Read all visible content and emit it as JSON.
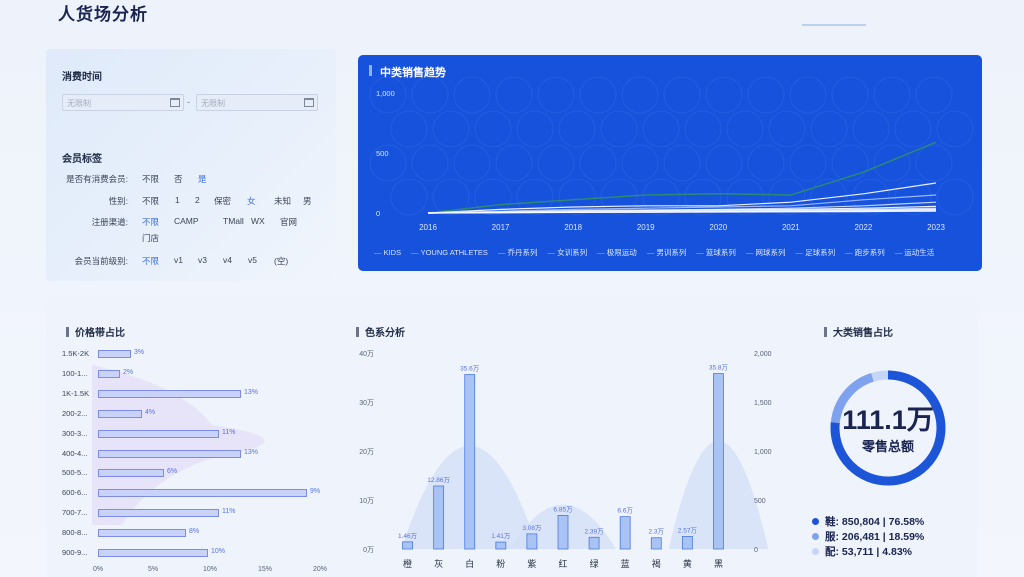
{
  "page": {
    "title": "人货场分析"
  },
  "filters": {
    "consume_time_label": "消费时间",
    "date_start_placeholder": "无限制",
    "date_end_placeholder": "无限制",
    "date_separator": "-",
    "member_tags_label": "会员标签",
    "rows": [
      {
        "label": "是否有消费会员:",
        "options": [
          "不限",
          "否",
          "是"
        ],
        "active": 2
      },
      {
        "label": "性别:",
        "options": [
          "不限",
          "1",
          "2",
          "保密",
          "女",
          "未知",
          "男"
        ],
        "active": 4
      },
      {
        "label": "注册渠道:",
        "options": [
          "不限",
          "CAMP",
          "TMall",
          "WX",
          "官网",
          "门店"
        ],
        "active": 0
      },
      {
        "label": "会员当前级别:",
        "options": [
          "不限",
          "v1",
          "v3",
          "v4",
          "v5",
          "(空)"
        ],
        "active": 0
      }
    ]
  },
  "trend": {
    "title": "中类销售趋势",
    "legend": [
      "KIDS",
      "YOUNG ATHLETES",
      "乔丹系列",
      "女训系列",
      "极限运动",
      "男训系列",
      "篮球系列",
      "网球系列",
      "足球系列",
      "跑步系列",
      "运动生活"
    ]
  },
  "chart_data": [
    {
      "type": "line",
      "title": "中类销售趋势",
      "x": [
        "2016",
        "2017",
        "2018",
        "2019",
        "2020",
        "2021",
        "2022",
        "2023"
      ],
      "yticks": [
        "0",
        "500",
        "1,000"
      ],
      "ylim": [
        0,
        1000
      ],
      "series": [
        {
          "name": "KIDS",
          "color": "#2e8f6a",
          "values": [
            0,
            70,
            110,
            150,
            160,
            150,
            340,
            590
          ]
        },
        {
          "name": "YOUNG ATHLETES",
          "color": "#ffffff",
          "values": [
            0,
            30,
            50,
            60,
            60,
            90,
            160,
            250
          ]
        },
        {
          "name": "乔丹系列",
          "color": "#a9c2ff",
          "values": [
            0,
            15,
            30,
            40,
            50,
            60,
            110,
            150
          ]
        },
        {
          "name": "女训系列",
          "color": "#d6e2ff",
          "values": [
            0,
            10,
            20,
            25,
            30,
            40,
            60,
            90
          ]
        },
        {
          "name": "极限运动",
          "color": "#c6d6ff",
          "values": [
            0,
            5,
            10,
            15,
            15,
            20,
            30,
            40
          ]
        },
        {
          "name": "男训系列",
          "color": "#ffffff",
          "values": [
            0,
            8,
            15,
            20,
            25,
            30,
            40,
            55
          ]
        },
        {
          "name": "篮球系列",
          "color": "#e3ebff",
          "values": [
            0,
            5,
            10,
            12,
            15,
            18,
            22,
            30
          ]
        },
        {
          "name": "网球系列",
          "color": "#b9ccff",
          "values": [
            0,
            3,
            6,
            8,
            10,
            12,
            16,
            20
          ]
        },
        {
          "name": "足球系列",
          "color": "#f0f4ff",
          "values": [
            0,
            4,
            8,
            10,
            12,
            15,
            18,
            25
          ]
        },
        {
          "name": "跑步系列",
          "color": "#dfe8ff",
          "values": [
            0,
            6,
            12,
            15,
            18,
            22,
            28,
            35
          ]
        },
        {
          "name": "运动生活",
          "color": "#ffffff",
          "values": [
            0,
            2,
            5,
            6,
            8,
            10,
            12,
            15
          ]
        }
      ]
    },
    {
      "type": "bar",
      "title": "价格带占比",
      "categories": [
        "1.5K-2K",
        "100-1...",
        "1K-1.5K",
        "200-2...",
        "300-3...",
        "400-4...",
        "500-5...",
        "600-6...",
        "700-7...",
        "800-8...",
        "900-9..."
      ],
      "values": [
        3,
        2,
        13,
        4,
        11,
        13,
        6,
        19,
        11,
        8,
        10
      ],
      "value_labels": [
        "3%",
        "2%",
        "13%",
        "4%",
        "11%",
        "13%",
        "6%",
        "9%",
        "11%",
        "8%",
        "10%"
      ],
      "xticks": [
        "0%",
        "5%",
        "10%",
        "15%",
        "20%"
      ],
      "xlim": [
        0,
        20
      ]
    },
    {
      "type": "bar",
      "title": "色系分析",
      "categories": [
        "橙",
        "灰",
        "白",
        "粉",
        "紫",
        "红",
        "绿",
        "蓝",
        "褐",
        "黄",
        "黑"
      ],
      "values": [
        1.46,
        12.86,
        35.6,
        1.41,
        3.08,
        6.85,
        2.39,
        6.6,
        2.3,
        2.57,
        35.8
      ],
      "value_labels": [
        "1.46万",
        "12.86万",
        "35.6万",
        "1.41万",
        "3.08万",
        "6.85万",
        "2.39万",
        "6.6万",
        "2.3万",
        "2.57万",
        "35.8万"
      ],
      "y_left_ticks": [
        "0万",
        "10万",
        "20万",
        "30万",
        "40万"
      ],
      "y_right_ticks": [
        "0",
        "500",
        "1,000",
        "1,500",
        "2,000"
      ],
      "ylim": [
        0,
        40
      ]
    },
    {
      "type": "pie",
      "title": "大类销售占比",
      "labels": [
        "鞋",
        "服",
        "配"
      ],
      "values": [
        850804,
        206481,
        53711
      ],
      "percents": [
        76.58,
        18.59,
        4.83
      ],
      "colors": [
        "#1c55d8",
        "#7fa2ee",
        "#c6d6f8"
      ]
    }
  ],
  "price_band": {
    "title": "价格带占比"
  },
  "color_analysis": {
    "title": "色系分析"
  },
  "category": {
    "title": "大类销售占比",
    "total_value": "111.1万",
    "total_label": "零售总额",
    "legend": [
      {
        "text": "鞋:  850,804  |   76.58%",
        "color": "#1c55d8"
      },
      {
        "text": "服:  206,481  |   18.59%",
        "color": "#7fa2ee"
      },
      {
        "text": "配:  53,711  |   4.83%",
        "color": "#c6d6f8"
      }
    ]
  }
}
